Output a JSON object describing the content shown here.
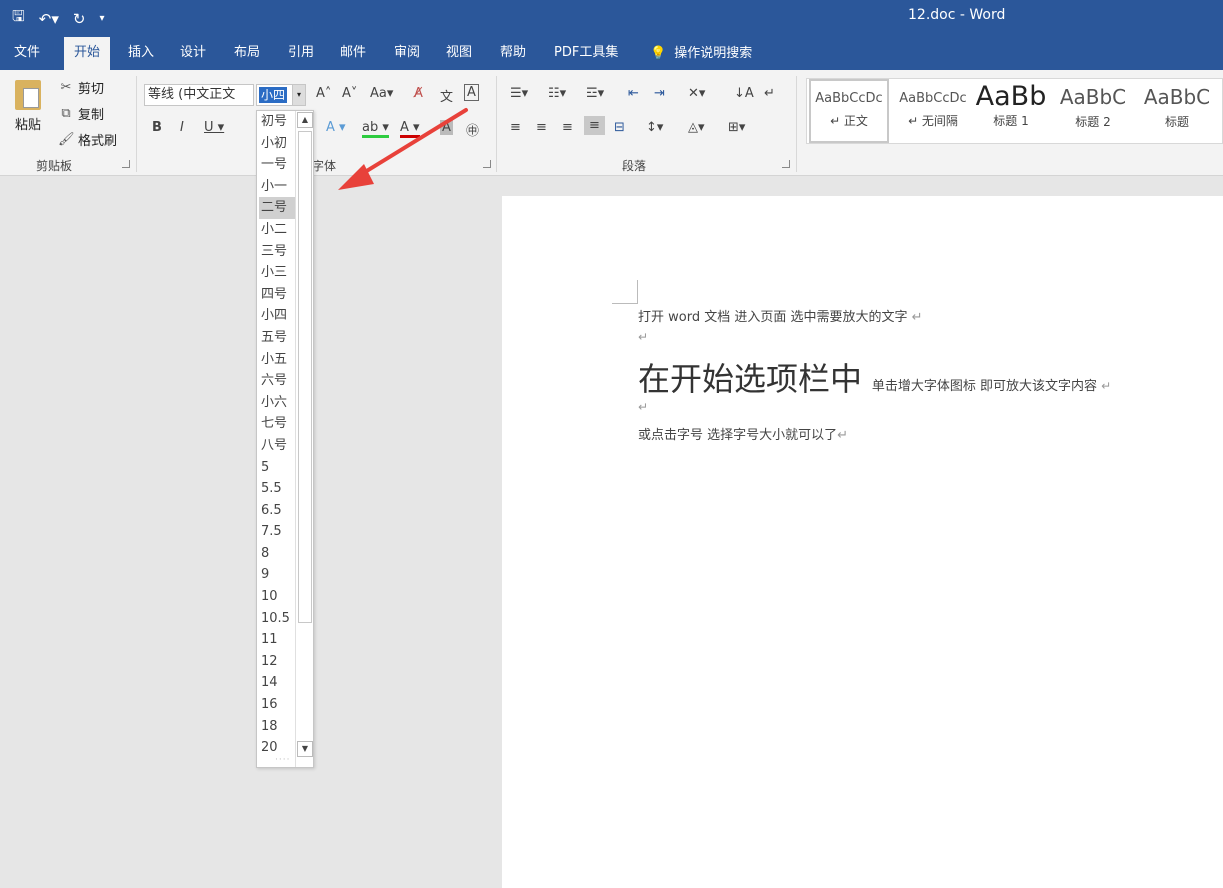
{
  "window": {
    "title": "12.doc  -  Word"
  },
  "qat": {
    "save_icon": "save-icon",
    "undo_icon": "undo-icon",
    "redo_icon": "redo-icon",
    "customize_icon": "customize-qat-icon"
  },
  "tabs": [
    {
      "label": "文件"
    },
    {
      "label": "开始"
    },
    {
      "label": "插入"
    },
    {
      "label": "设计"
    },
    {
      "label": "布局"
    },
    {
      "label": "引用"
    },
    {
      "label": "邮件"
    },
    {
      "label": "审阅"
    },
    {
      "label": "视图"
    },
    {
      "label": "帮助"
    },
    {
      "label": "PDF工具集"
    }
  ],
  "tell_me": {
    "label": "操作说明搜索"
  },
  "clipboard": {
    "paste": "粘贴",
    "cut": "剪切",
    "copy": "复制",
    "format_painter": "格式刷",
    "group_label": "剪贴板"
  },
  "font": {
    "name": "等线 (中文正文",
    "size": "小四",
    "group_label": "字体"
  },
  "paragraph": {
    "group_label": "段落"
  },
  "styles": [
    {
      "sample": "AaBbCcDc",
      "name": "↵ 正文"
    },
    {
      "sample": "AaBbCcDc",
      "name": "↵ 无间隔"
    },
    {
      "sample": "AaBb",
      "name": "标题 1"
    },
    {
      "sample": "AaBbC",
      "name": "标题 2"
    },
    {
      "sample": "AaBbC",
      "name": "标题"
    }
  ],
  "size_options": [
    "初号",
    "小初",
    "一号",
    "小一",
    "二号",
    "小二",
    "三号",
    "小三",
    "四号",
    "小四",
    "五号",
    "小五",
    "六号",
    "小六",
    "七号",
    "八号",
    "5",
    "5.5",
    "6.5",
    "7.5",
    "8",
    "9",
    "10",
    "10.5",
    "11",
    "12",
    "14",
    "16",
    "18",
    "20"
  ],
  "document": {
    "line1": "打开 word 文档   进入页面   选中需要放大的文字  ",
    "line2_big": "在开始选项栏中",
    "line2_small": "单击增大字体图标   即可放大该文字内容  ",
    "line3": "或点击字号     选择字号大小就可以了",
    "para_mark": "↵"
  }
}
